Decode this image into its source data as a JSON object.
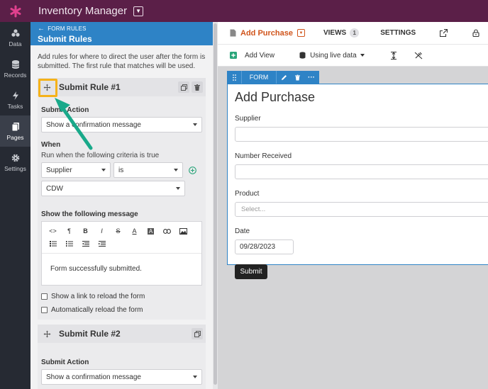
{
  "app": {
    "title": "Inventory Manager"
  },
  "nav": [
    {
      "label": "Data",
      "icon": "data-icon"
    },
    {
      "label": "Records",
      "icon": "database-icon"
    },
    {
      "label": "Tasks",
      "icon": "lightning-icon"
    },
    {
      "label": "Pages",
      "icon": "pages-icon",
      "active": true
    },
    {
      "label": "Settings",
      "icon": "gear-icon"
    }
  ],
  "panel": {
    "back_label": "FORM RULES",
    "title": "Submit Rules",
    "description": "Add rules for where to direct the user after the form is submitted. The first rule that matches will be used."
  },
  "rule1": {
    "title": "Submit Rule #1",
    "action_label": "Submit Action",
    "action_value": "Show a confirmation message",
    "when_label": "When",
    "criteria_text": "Run when the following criteria is true",
    "field_value": "Supplier",
    "operator_value": "is",
    "match_value": "CDW",
    "message_label": "Show the following message",
    "message_text": "Form successfully submitted.",
    "reload_link_label": "Show a link to reload the form",
    "auto_reload_label": "Automatically reload the form"
  },
  "rule2": {
    "title": "Submit Rule #2",
    "action_label": "Submit Action",
    "action_value": "Show a confirmation message"
  },
  "header": {
    "page_title": "Add Purchase",
    "views_label": "VIEWS",
    "views_count": "1",
    "settings_label": "SETTINGS"
  },
  "subtools": {
    "add_view_label": "Add View",
    "live_data_label": "Using live data"
  },
  "form": {
    "tab_label": "FORM",
    "title": "Add Purchase",
    "fields": [
      {
        "label": "Supplier",
        "placeholder": ""
      },
      {
        "label": "Number Received",
        "placeholder": ""
      },
      {
        "label": "Product",
        "placeholder": "Select..."
      }
    ],
    "date_label": "Date",
    "date_value": "09/28/2023",
    "submit_label": "Submit"
  },
  "colors": {
    "topbar": "#5b1f48",
    "accent_blue": "#2e83c6",
    "page_title_orange": "#d0541b",
    "highlight_yellow": "#f5b21a",
    "arrow_teal": "#19a98a"
  }
}
